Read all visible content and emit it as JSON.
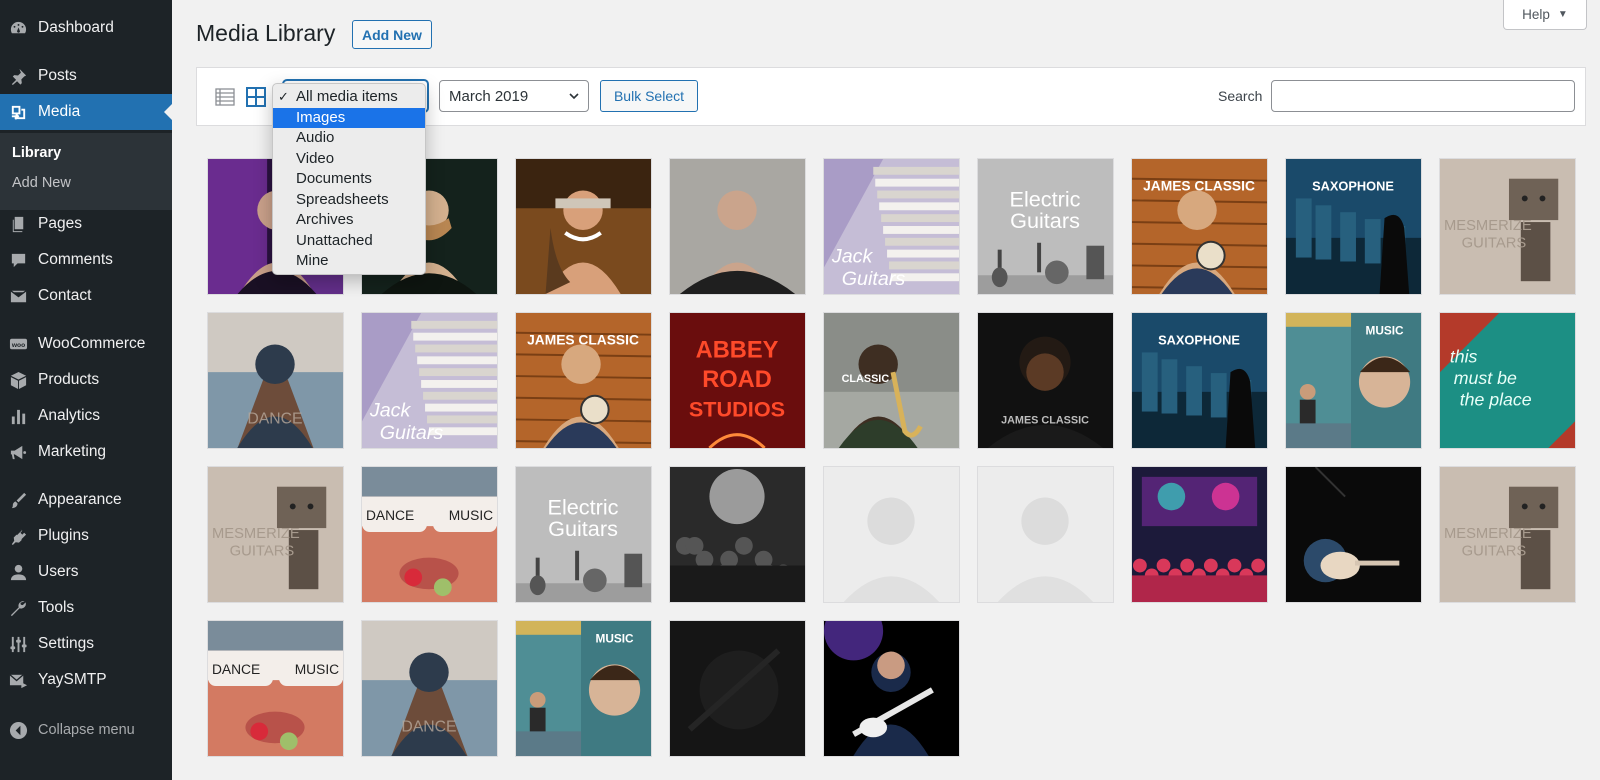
{
  "sidebar": {
    "items": [
      {
        "label": "Dashboard",
        "icon": "dashboard-icon"
      },
      {
        "label": "Posts",
        "icon": "pin-icon"
      },
      {
        "label": "Media",
        "icon": "media-icon",
        "active": true
      },
      {
        "label": "Pages",
        "icon": "pages-icon"
      },
      {
        "label": "Comments",
        "icon": "comment-icon"
      },
      {
        "label": "Contact",
        "icon": "mail-icon"
      },
      {
        "label": "WooCommerce",
        "icon": "woo-icon"
      },
      {
        "label": "Products",
        "icon": "box-icon"
      },
      {
        "label": "Analytics",
        "icon": "bar-chart-icon"
      },
      {
        "label": "Marketing",
        "icon": "megaphone-icon"
      },
      {
        "label": "Appearance",
        "icon": "brush-icon"
      },
      {
        "label": "Plugins",
        "icon": "plug-icon"
      },
      {
        "label": "Users",
        "icon": "user-icon"
      },
      {
        "label": "Tools",
        "icon": "wrench-icon"
      },
      {
        "label": "Settings",
        "icon": "settings-icon"
      },
      {
        "label": "YaySMTP",
        "icon": "mail-send-icon"
      }
    ],
    "submenu": [
      {
        "label": "Library",
        "current": true
      },
      {
        "label": "Add New",
        "current": false
      }
    ],
    "collapse_label": "Collapse menu"
  },
  "header": {
    "title": "Media Library",
    "add_new_label": "Add New",
    "help_label": "Help"
  },
  "toolbar": {
    "type_filter": {
      "selected": "All media items",
      "highlighted": "Images",
      "options": [
        "All media items",
        "Images",
        "Audio",
        "Video",
        "Documents",
        "Spreadsheets",
        "Archives",
        "Unattached",
        "Mine"
      ]
    },
    "date_filter": "March 2019",
    "bulk_select_label": "Bulk Select",
    "search_label": "Search",
    "search_value": ""
  },
  "colors": {
    "sidebar_bg": "#1d2327",
    "accent": "#2271b1",
    "highlight": "#1a73e8"
  },
  "media": [
    {
      "kind": "portrait-purple"
    },
    {
      "kind": "portrait-beard"
    },
    {
      "kind": "smiling-man"
    },
    {
      "kind": "man-earphones"
    },
    {
      "kind": "books",
      "text": [
        "Jack",
        "Guitars"
      ]
    },
    {
      "kind": "gray-text",
      "text": [
        "Electric",
        "Guitars"
      ]
    },
    {
      "kind": "wood-banjo",
      "text": [
        "JAMES CLASSIC"
      ]
    },
    {
      "kind": "saxophone",
      "text": [
        "SAXOPHONE"
      ]
    },
    {
      "kind": "robot",
      "text": [
        "MESMERIZE",
        "GUITARS"
      ]
    },
    {
      "kind": "pier",
      "text": [
        "DANCE"
      ]
    },
    {
      "kind": "books",
      "text": [
        "Jack",
        "Guitars"
      ]
    },
    {
      "kind": "wood-banjo",
      "text": [
        "JAMES CLASSIC"
      ]
    },
    {
      "kind": "neon-red",
      "text": [
        "ABBEY",
        "ROAD",
        "STUDIOS"
      ]
    },
    {
      "kind": "sax-player",
      "text": [
        "CLASSIC"
      ]
    },
    {
      "kind": "dark-man",
      "text": [
        "JAMES CLASSIC"
      ]
    },
    {
      "kind": "saxophone",
      "text": [
        "SAXOPHONE"
      ]
    },
    {
      "kind": "music-girl",
      "text": [
        "MUSIC"
      ]
    },
    {
      "kind": "neon-teal",
      "text": [
        "this",
        "must be",
        "the place"
      ]
    },
    {
      "kind": "robot",
      "text": [
        "MESMERIZE",
        "GUITARS"
      ]
    },
    {
      "kind": "sunglasses",
      "text": [
        "DANCE",
        "MUSIC"
      ]
    },
    {
      "kind": "gray-text",
      "text": [
        "Electric",
        "Guitars"
      ]
    },
    {
      "kind": "crowd-bw"
    },
    {
      "kind": "faded"
    },
    {
      "kind": "faded"
    },
    {
      "kind": "concert"
    },
    {
      "kind": "guitar-dark"
    },
    {
      "kind": "robot",
      "text": [
        "MESMERIZE",
        "GUITARS"
      ]
    },
    {
      "kind": "sunglasses",
      "text": [
        "DANCE",
        "MUSIC"
      ]
    },
    {
      "kind": "pier",
      "text": [
        "DANCE"
      ]
    },
    {
      "kind": "music-girl",
      "text": [
        "MUSIC"
      ]
    },
    {
      "kind": "black-texture"
    },
    {
      "kind": "guitarist-purple"
    }
  ]
}
